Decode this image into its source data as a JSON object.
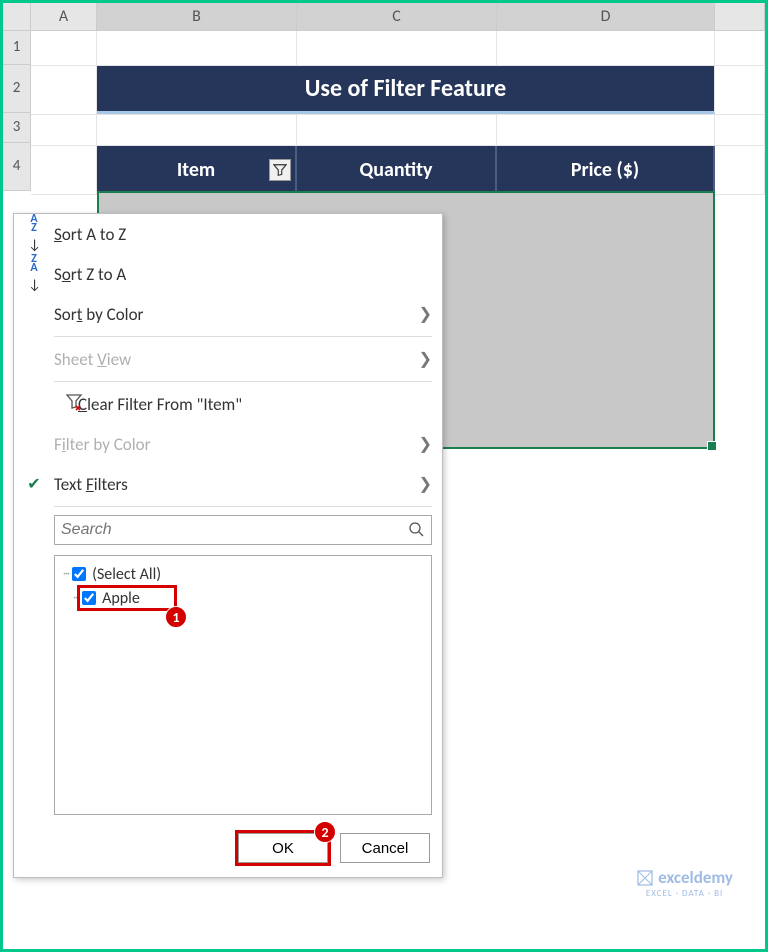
{
  "columns": {
    "A": "A",
    "B": "B",
    "C": "C",
    "D": "D"
  },
  "rows": {
    "r1": "1",
    "r2": "2",
    "r3": "3",
    "r4": "4"
  },
  "title": "Use of Filter Feature",
  "headers": {
    "item": "Item",
    "qty": "Quantity",
    "price": "Price ($)"
  },
  "menu": {
    "sort_az": "Sort A to Z",
    "sort_za": "Sort Z to A",
    "sort_color": "Sort by Color",
    "sheet_view": "Sheet View",
    "clear_filter": "Clear Filter From \"Item\"",
    "filter_color": "Filter by Color",
    "text_filters": "Text Filters",
    "search_ph": "Search",
    "select_all": "(Select All)",
    "apple": "Apple",
    "ok": "OK",
    "cancel": "Cancel"
  },
  "callouts": {
    "one": "1",
    "two": "2"
  },
  "watermark": {
    "brand": "exceldemy",
    "sub": "EXCEL · DATA · BI"
  }
}
